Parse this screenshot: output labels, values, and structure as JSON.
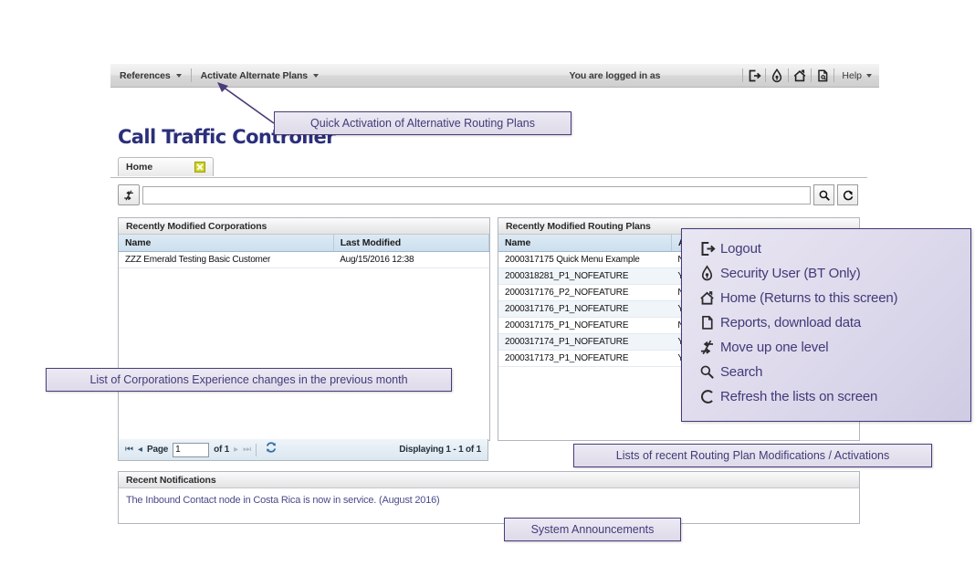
{
  "toolbar": {
    "menus": [
      {
        "label": "References",
        "icon": "chevron-down-icon"
      },
      {
        "label": "Activate Alternate Plans",
        "icon": "chevron-down-icon"
      }
    ],
    "logged_in_text": "You are logged in as",
    "logged_in_user": "",
    "icons": [
      "logout-icon",
      "security-user-icon",
      "home-icon",
      "reports-icon"
    ],
    "help_label": "Help"
  },
  "page": {
    "title": "Call Traffic Controller",
    "tab": {
      "label": "Home",
      "close_icon": "close-icon"
    }
  },
  "search": {
    "up_level_icon": "move-up-one-level-icon",
    "value": "",
    "placeholder": "",
    "search_icon": "search-icon",
    "refresh_icon": "refresh-icon"
  },
  "corporations_panel": {
    "title": "Recently Modified Corporations",
    "columns": [
      "Name",
      "Last Modified"
    ],
    "rows": [
      [
        "ZZZ Emerald Testing Basic Customer",
        "Aug/15/2016 12:38"
      ]
    ]
  },
  "pager": {
    "first_icon": "first-page-icon",
    "prev_icon": "prev-page-icon",
    "page_label": "Page",
    "page_value": "1",
    "of_label": "of 1",
    "next_icon": "next-page-icon",
    "last_icon": "last-page-icon",
    "refresh_icon": "refresh-icon",
    "count_text": "Displaying 1 - 1 of 1"
  },
  "routing_plans_panel": {
    "title": "Recently Modified Routing Plans",
    "columns": [
      "Name",
      "Ac"
    ],
    "rows": [
      [
        "2000317175 Quick Menu Example",
        "N"
      ],
      [
        "2000318281_P1_NOFEATURE",
        "Y"
      ],
      [
        "2000317176_P2_NOFEATURE",
        "N"
      ],
      [
        "2000317176_P1_NOFEATURE",
        "Y"
      ],
      [
        "2000317175_P1_NOFEATURE",
        "N"
      ],
      [
        "2000317174_P1_NOFEATURE",
        "Y"
      ],
      [
        "2000317173_P1_NOFEATURE",
        "Y"
      ]
    ]
  },
  "notifications_panel": {
    "title": "Recent Notifications",
    "text": "The Inbound Contact node in Costa Rica is now in service.  (August 2016)"
  },
  "callouts": {
    "quick_activation": "Quick Activation of Alternative Routing Plans",
    "corporations": "List of Corporations Experience changes in the previous month",
    "routing": "Lists of recent Routing Plan Modifications / Activations",
    "system_announcements": "System Announcements"
  },
  "legend": {
    "items": [
      {
        "icon": "logout-icon",
        "label": "Logout"
      },
      {
        "icon": "security-user-icon",
        "label": "Security User (BT Only)"
      },
      {
        "icon": "home-icon",
        "label": "Home (Returns to this screen)"
      },
      {
        "icon": "reports-icon",
        "label": "Reports, download data"
      },
      {
        "icon": "move-up-one-level-icon",
        "label": "Move up one level"
      },
      {
        "icon": "search-icon",
        "label": "Search"
      },
      {
        "icon": "refresh-icon",
        "label": "Refresh the lists on screen"
      }
    ]
  },
  "colors": {
    "title": "#2b2f7a",
    "callout_text": "#413a78",
    "callout_border": "#4b3b78",
    "notification_text": "#4a4a8c",
    "grid_header": "#cddfee",
    "tab_close": "#cfd41f"
  }
}
